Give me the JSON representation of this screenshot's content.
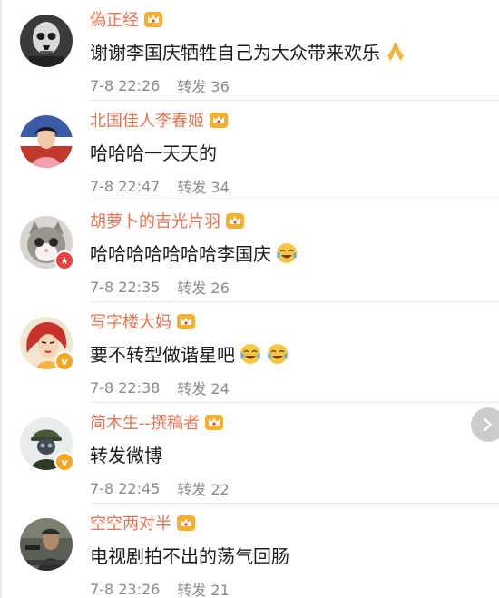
{
  "comments": [
    {
      "username": "偽正经",
      "text": "谢谢李国庆牺牲自己为大众带来欢乐",
      "emoji": "folded-hands-icon",
      "time": "7-8 22:26",
      "repost": "转发 36",
      "badge": null,
      "avatar": "skull-man-avatar"
    },
    {
      "username": "北国佳人李春姬",
      "text": "哈哈哈一天天的",
      "emoji": null,
      "time": "7-8 22:47",
      "repost": "转发 34",
      "badge": null,
      "avatar": "news-anchor-avatar"
    },
    {
      "username": "胡萝卜的吉光片羽",
      "text": "哈哈哈哈哈哈哈李国庆",
      "emoji": "laugh-cry-icon",
      "time": "7-8 22:35",
      "repost": "转发 26",
      "badge": "red",
      "avatar": "cat-avatar"
    },
    {
      "username": "写字楼大妈",
      "text": "要不转型做谐星吧",
      "emoji": "laugh-cry-icon-double",
      "time": "7-8 22:38",
      "repost": "转发 24",
      "badge": "orange",
      "avatar": "retro-woman-avatar"
    },
    {
      "username": "简木生--撰稿者",
      "text": "转发微博",
      "emoji": null,
      "time": "7-8 22:45",
      "repost": "转发 22",
      "badge": "orange",
      "avatar": "soldier-avatar"
    },
    {
      "username": "空空两对半",
      "text": "电视剧拍不出的荡气回肠",
      "emoji": null,
      "time": "7-8 23:26",
      "repost": "转发 21",
      "badge": null,
      "avatar": "movie-scene-avatar"
    }
  ],
  "colors": {
    "username": "#eb7350",
    "meta": "#8a8a8a",
    "crown": "#f6b12c"
  },
  "badges": {
    "orange_glyph": "v",
    "red_glyph": "★"
  }
}
